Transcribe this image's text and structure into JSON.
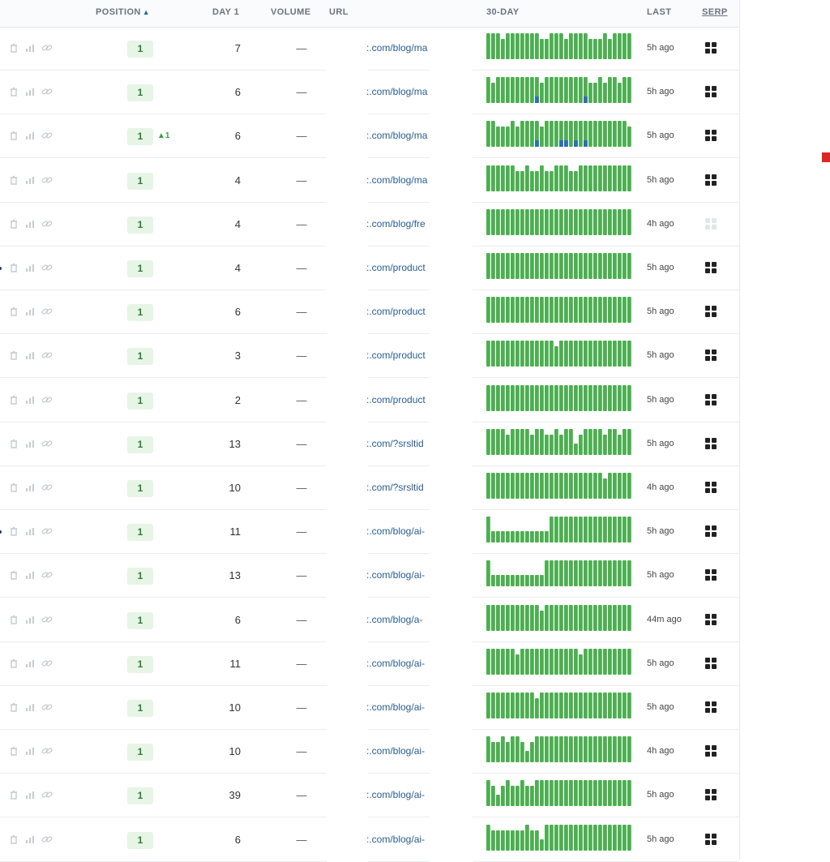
{
  "header": {
    "position": "POSITION",
    "sort_arrow": "▲",
    "day1": "DAY 1",
    "volume": "VOLUME",
    "url": "URL",
    "thirty_day": "30-DAY",
    "last": "LAST",
    "serp": "SERP"
  },
  "colors": {
    "bar_green": "#4caf50",
    "bar_blue": "#2f6db5",
    "position_bg": "#e6f5e6",
    "position_text": "#2e7d32"
  },
  "icons": [
    "trash-icon",
    "bar-chart-icon",
    "link-icon",
    "serp-grid-icon"
  ],
  "rows": [
    {
      "position": "1",
      "delta": "",
      "day1": "7",
      "volume": "—",
      "url": ":.com/blog/ma",
      "last": "5h ago",
      "serp_active": true,
      "dot": false,
      "trend": [
        1,
        1,
        1,
        1,
        1,
        1,
        1,
        1,
        1,
        1,
        1,
        1,
        1,
        1,
        1,
        1,
        1,
        1,
        1,
        1,
        1,
        1,
        1,
        1,
        1,
        1,
        1,
        1,
        1,
        1
      ],
      "bars": "HHHTHHHHHHHTTHHHTHHHHTTTHTHHHH"
    },
    {
      "position": "1",
      "delta": "",
      "day1": "6",
      "volume": "—",
      "url": ":.com/blog/ma",
      "last": "5h ago",
      "serp_active": true,
      "dot": false,
      "bars": "HTHHHHHHHHbTHHHHHHHHbTTHTHHTHH"
    },
    {
      "position": "1",
      "delta": "▲1",
      "day1": "6",
      "volume": "—",
      "url": ":.com/blog/ma",
      "last": "5h ago",
      "serp_active": true,
      "dot": false,
      "bars": "HHTTTHTHHHbTHHHbbHbHbHHHHHHHHT"
    },
    {
      "position": "1",
      "delta": "",
      "day1": "4",
      "volume": "—",
      "url": ":.com/blog/ma",
      "last": "5h ago",
      "serp_active": true,
      "dot": false,
      "bars": "HHHHHHTTHTTHTTHHHTTHHHHHHHHHHH"
    },
    {
      "position": "1",
      "delta": "",
      "day1": "4",
      "volume": "—",
      "url": ":.com/blog/fre",
      "last": "4h ago",
      "serp_active": false,
      "dot": false,
      "bars": "HHHHHHHHHHHHHHHHHHHHHHHHHHHHHH"
    },
    {
      "position": "1",
      "delta": "",
      "day1": "4",
      "volume": "—",
      "url": ":.com/product",
      "last": "5h ago",
      "serp_active": true,
      "dot": true,
      "bars": "HHHHHHHHHHHHHHHHHHHHHHHHHHHHHH"
    },
    {
      "position": "1",
      "delta": "",
      "day1": "6",
      "volume": "—",
      "url": ":.com/product",
      "last": "5h ago",
      "serp_active": true,
      "dot": false,
      "bars": "HHHHHHHHHHHHHHHHHHHHHHHHHHHHHH"
    },
    {
      "position": "1",
      "delta": "",
      "day1": "3",
      "volume": "—",
      "url": ":.com/product",
      "last": "5h ago",
      "serp_active": true,
      "dot": false,
      "bars": "HHHHHHHHHHHHHHTHHHHHHHHHHHHHHH"
    },
    {
      "position": "1",
      "delta": "",
      "day1": "2",
      "volume": "—",
      "url": ":.com/product",
      "last": "5h ago",
      "serp_active": true,
      "dot": false,
      "bars": "HHHHHHHHHHHHHHHHHHHHHHHHHHHHHH"
    },
    {
      "position": "1",
      "delta": "",
      "day1": "13",
      "volume": "—",
      "url": ":.com/?srsltid",
      "last": "5h ago",
      "serp_active": true,
      "dot": false,
      "bars": "HHHHTHHHHTHHTTHTHHLTHHHHTHHTHH"
    },
    {
      "position": "1",
      "delta": "",
      "day1": "10",
      "volume": "—",
      "url": ":.com/?srsltid",
      "last": "4h ago",
      "serp_active": true,
      "dot": false,
      "bars": "HHHHHHHHHHHHHHHHHHHHHHHHTHHHHH"
    },
    {
      "position": "1",
      "delta": "",
      "day1": "11",
      "volume": "—",
      "url": ":.com/blog/ai-",
      "last": "5h ago",
      "serp_active": true,
      "dot": true,
      "bars": "HLLLLLLLLLLLLHHHHHHHHHHHHHHHHH"
    },
    {
      "position": "1",
      "delta": "",
      "day1": "13",
      "volume": "—",
      "url": ":.com/blog/ai-",
      "last": "5h ago",
      "serp_active": true,
      "dot": false,
      "bars": "HLLLLLLLLLLLHHHHHHHHHHHHHHHHHH"
    },
    {
      "position": "1",
      "delta": "",
      "day1": "6",
      "volume": "—",
      "url": ":.com/blog/a-",
      "last": "44m ago",
      "serp_active": true,
      "dot": false,
      "bars": "HHHHHHHHHHHTHHHHHHHHHHHHHHHHHH"
    },
    {
      "position": "1",
      "delta": "",
      "day1": "11",
      "volume": "—",
      "url": ":.com/blog/ai-",
      "last": "5h ago",
      "serp_active": true,
      "dot": false,
      "bars": "HHHHHHTHHHHHHHHHHHHTHHHHHHHHHH"
    },
    {
      "position": "1",
      "delta": "",
      "day1": "10",
      "volume": "—",
      "url": ":.com/blog/ai-",
      "last": "5h ago",
      "serp_active": true,
      "dot": false,
      "bars": "HHHHHHHHHHTHHHHHHHHHHHHHHHHHHH"
    },
    {
      "position": "1",
      "delta": "",
      "day1": "10",
      "volume": "—",
      "url": ":.com/blog/ai-",
      "last": "4h ago",
      "serp_active": true,
      "dot": false,
      "bars": "HTTHTHHTLTHHHHHHHHHHHHHHHHHHHH"
    },
    {
      "position": "1",
      "delta": "",
      "day1": "39",
      "volume": "—",
      "url": ":.com/blog/ai-",
      "last": "5h ago",
      "serp_active": true,
      "dot": false,
      "bars": "HTLTHTTHTTHHHHHHHHHHHHHHHHHHHH"
    },
    {
      "position": "1",
      "delta": "",
      "day1": "6",
      "volume": "—",
      "url": ":.com/blog/ai-",
      "last": "5h ago",
      "serp_active": true,
      "dot": false,
      "bars": "HTTTTTTTHTTLHHHHHHHHHHHHHHHHHH"
    }
  ]
}
